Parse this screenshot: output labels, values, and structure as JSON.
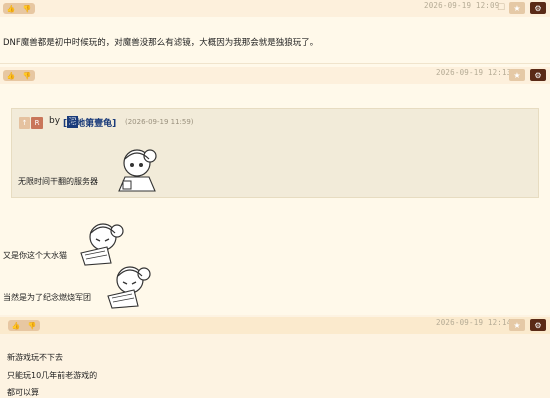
{
  "posts": [
    {
      "timestamp": "2026-09-19 12:09",
      "lines": [
        "DNF魔兽都是初中时候玩的，对魔兽没那么有滤镜，大概因为我那会就是独狼玩了。"
      ]
    },
    {
      "timestamp": "2026-09-19 12:13",
      "quote": {
        "badge1": "↑",
        "badge2": "R",
        "by": "by",
        "author": "[尼地第壹龟]",
        "author_icon": "泥",
        "time": "(2026-09-19 11:59)",
        "text": "无限时间干翻的服务器"
      },
      "lines": [
        "又是你这个大水猫",
        "当然是为了纪念燃烧军团"
      ]
    },
    {
      "timestamp": "2026-09-19 12:14",
      "lines": [
        "新游戏玩不下去",
        "只能玩10几年前老游戏的",
        "都可以算"
      ]
    }
  ],
  "icons": {
    "thumbs_up": "thumbs-up-icon",
    "thumbs_down": "thumbs-down-icon",
    "star": "star-icon",
    "gear": "gear-icon",
    "dice": "dice-icon"
  },
  "colors": {
    "background": "#fff9ea",
    "bar": "#fdf0dc",
    "pill": "#e7c7a2",
    "gear_button": "#5a2a16",
    "quote_bg": "#f2ebd9",
    "author": "#1a3b7a"
  }
}
